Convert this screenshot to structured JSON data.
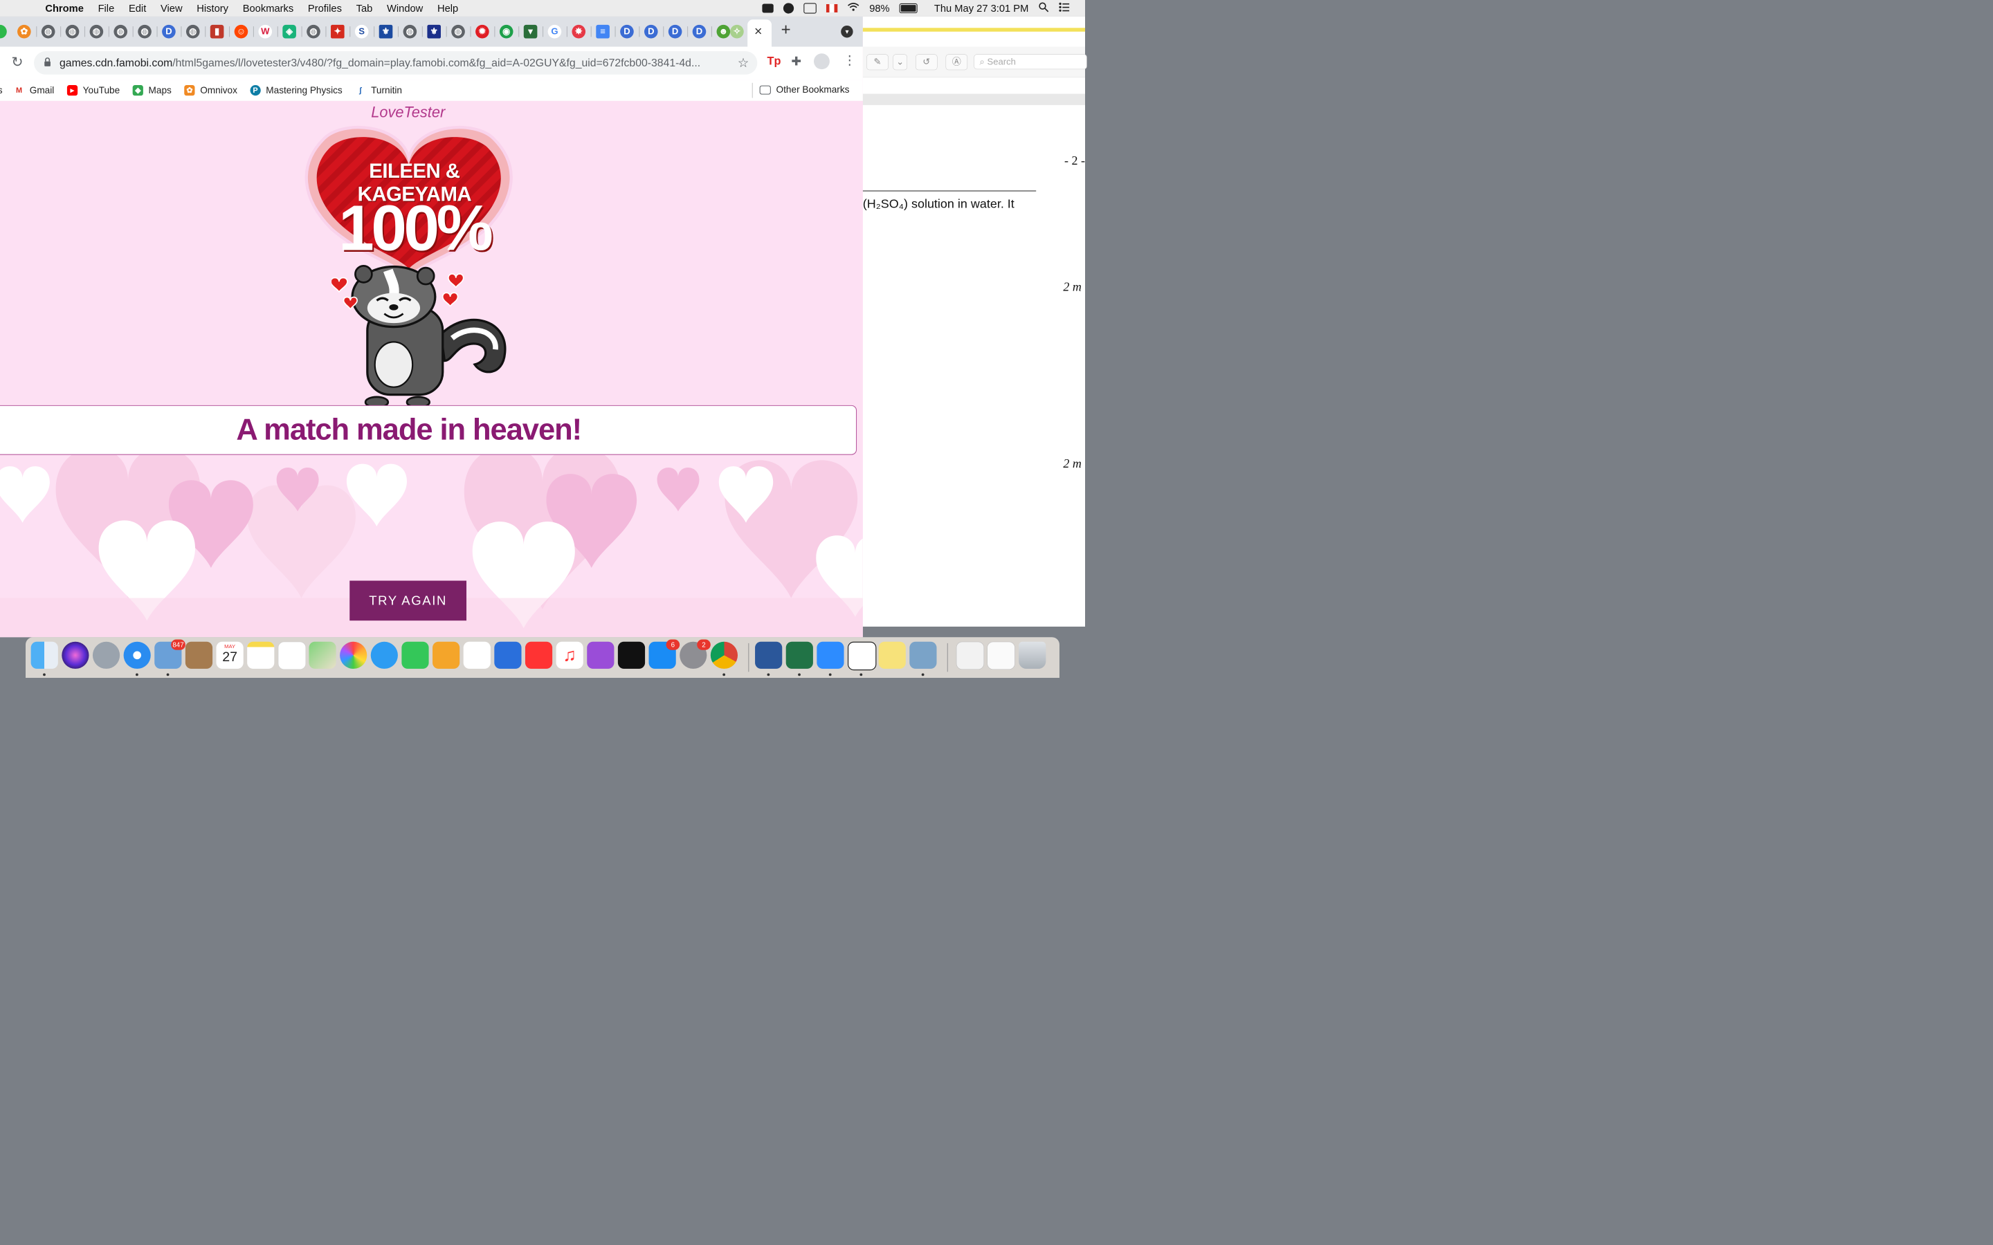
{
  "menubar": {
    "app": "Chrome",
    "items": [
      "File",
      "Edit",
      "View",
      "History",
      "Bookmarks",
      "Profiles",
      "Tab",
      "Window",
      "Help"
    ],
    "battery": "98%",
    "datetime": "Thu May 27  3:01 PM"
  },
  "browser": {
    "url_host": "games.cdn.famobi.com",
    "url_path": "/html5games/l/lovetester3/v480/?fg_domain=play.famobi.com&fg_aid=A-02GUY&fg_uid=672fcb00-3841-4d...",
    "new_tab": "+",
    "close_tab": "×",
    "bookmarks": [
      "Gmail",
      "YouTube",
      "Maps",
      "Omnivox",
      "Mastering Physics",
      "Turnitin"
    ],
    "bookmark_first_partial": "s",
    "other_bookmarks": "Other Bookmarks",
    "extension_tp": "Tp"
  },
  "game": {
    "logo": "LoveTester",
    "names": "EILEEN & KAGEYAMA",
    "percent": "100%",
    "result": "A match made in heaven!",
    "try_again": "TRY AGAIN"
  },
  "document": {
    "search_placeholder": "Search",
    "page_num": "- 2 -",
    "line1": "(H₂SO₄) solution in water. It",
    "marks1": "2 m",
    "marks2": "2 m"
  },
  "dock": {
    "badges": {
      "mail": "847",
      "calendar_day": "27",
      "calendar_month": "MAY",
      "appstore": "6",
      "settings": "2"
    }
  },
  "colors": {
    "game_bg": "#fde0f3",
    "heart_red": "#d4141d",
    "result_text": "#8a1a72",
    "button_bg": "#7a2166"
  }
}
